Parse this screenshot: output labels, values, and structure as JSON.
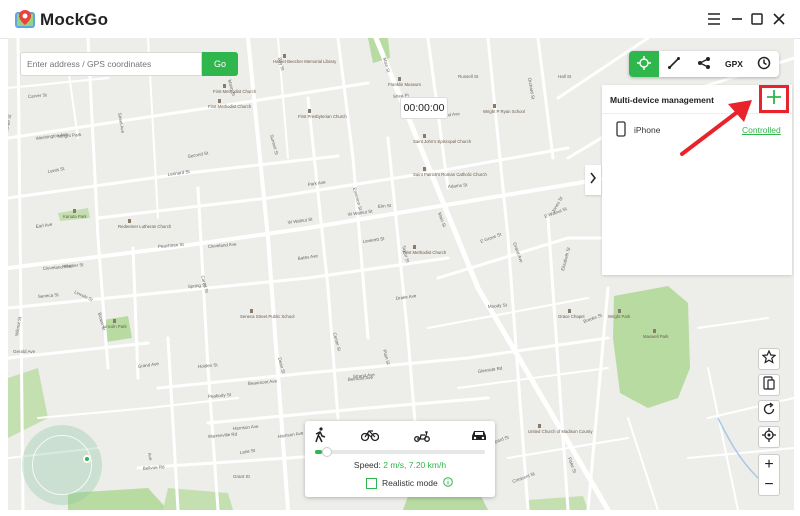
{
  "app": {
    "title": "MockGo"
  },
  "search": {
    "placeholder": "Enter address / GPS coordinates",
    "go_label": "Go"
  },
  "timer": {
    "value": "00:00:00"
  },
  "toolbar": {
    "gpx_label": "GPX"
  },
  "panel": {
    "title": "Multi-device management",
    "devices": [
      {
        "name": "iPhone",
        "status": "Controlled"
      }
    ]
  },
  "speed": {
    "prefix": "Speed: ",
    "value": "2 m/s, 7.20 km/h",
    "realistic_label": "Realistic mode",
    "level": 0.04
  },
  "map": {
    "streets": [
      "Winter St",
      "Washington Ave",
      "Leonard St",
      "Park Ave",
      "Earl Ave",
      "Cleveland Ave",
      "Cleveland Ave",
      "W Walnut St",
      "W Walnut St",
      "Bates Ave",
      "Drake Ave",
      "Beaumont Ave",
      "Belmont Ave",
      "Harrison Ave",
      "Harrison Ave",
      "Glenside Rd",
      "Bellvue Rd",
      "Grant St",
      "Main St",
      "E Grove St",
      "Grand Ave",
      "Jones St",
      "Elizabeth St",
      "E Walnut St",
      "Fiske St",
      "Main St",
      "Brown St",
      "Lincoln St",
      "Grand Ave",
      "Summit St",
      "Carrol St",
      "Center St",
      "Taylor St",
      "Jenkins St",
      "Brooks St",
      "Lane St",
      "Strand Ave",
      "Wilmot St",
      "Gerald Ave",
      "Mann St",
      "Russell St",
      "Orchard St",
      "Hall St",
      "Lewis St",
      "Second St",
      "Elm St",
      "Emerson St",
      "Plain St",
      "Shepard St",
      "Crescent St",
      "Leverett St",
      "Bay St",
      "Dean St",
      "Street Ave",
      "Ave",
      "Peachtree St",
      "Spring St",
      "Holden St",
      "Peabody St",
      "Greenwood Ave",
      "Carver St",
      "Whittier St",
      "Seneca St",
      "Pleasant St",
      "Wright Park",
      "Warrenville Rd",
      "Adams St",
      "Moody St",
      "Shea Pl"
    ],
    "pois": [
      "Harriet Beecher Memorial Library",
      "First Methodist Church",
      "Kanata Park",
      "Redeemer Lutheran Church",
      "First Presbyterian Church",
      "Lincoln Park",
      "Seneca Street Public School",
      "Saint John's Episcopal Church",
      "Saint Patrick's Roman Catholic Church",
      "First Methodist Church",
      "Franklin Museum",
      "First Methodist Church",
      "Wright P Ryan School",
      "Maxwell Park",
      "Mishawaka Library",
      "United Church of Madison County",
      "Grace Chapel",
      "Wright Park"
    ]
  },
  "colors": {
    "accent": "#2fb64c",
    "highlight": "#e8232b"
  }
}
